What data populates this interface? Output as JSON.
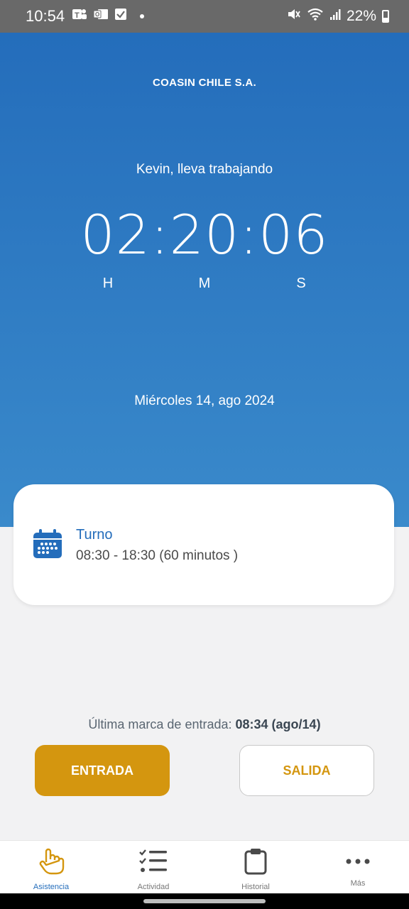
{
  "status_bar": {
    "time": "10:54",
    "battery": "22%",
    "icons": [
      "teams-icon",
      "outlook-icon",
      "check-icon",
      "mute-icon",
      "wifi-icon",
      "signal-icon",
      "battery-icon"
    ]
  },
  "hero": {
    "company": "COASIN CHILE S.A.",
    "greeting": "Kevin, lleva trabajando",
    "timer": "02:20:06",
    "units": {
      "h": "H",
      "m": "M",
      "s": "S"
    },
    "date": "Miércoles 14, ago 2024"
  },
  "shift": {
    "title": "Turno",
    "hours": "08:30 - 18:30 (60 minutos )",
    "icon": "calendar-icon"
  },
  "last_mark": {
    "label": "Última marca de entrada:",
    "value": "08:34 (ago/14)"
  },
  "actions": {
    "entrada": "ENTRADA",
    "salida": "SALIDA"
  },
  "nav": {
    "items": [
      {
        "label": "Asistencia",
        "icon": "hand-pointer-icon",
        "active": true
      },
      {
        "label": "Actividad",
        "icon": "checklist-icon",
        "active": false
      },
      {
        "label": "Historial",
        "icon": "clipboard-icon",
        "active": false
      },
      {
        "label": "Más",
        "icon": "more-icon",
        "active": false
      }
    ]
  },
  "colors": {
    "primary": "#246dbb",
    "accent": "#d4960f",
    "background": "#f2f2f3"
  }
}
